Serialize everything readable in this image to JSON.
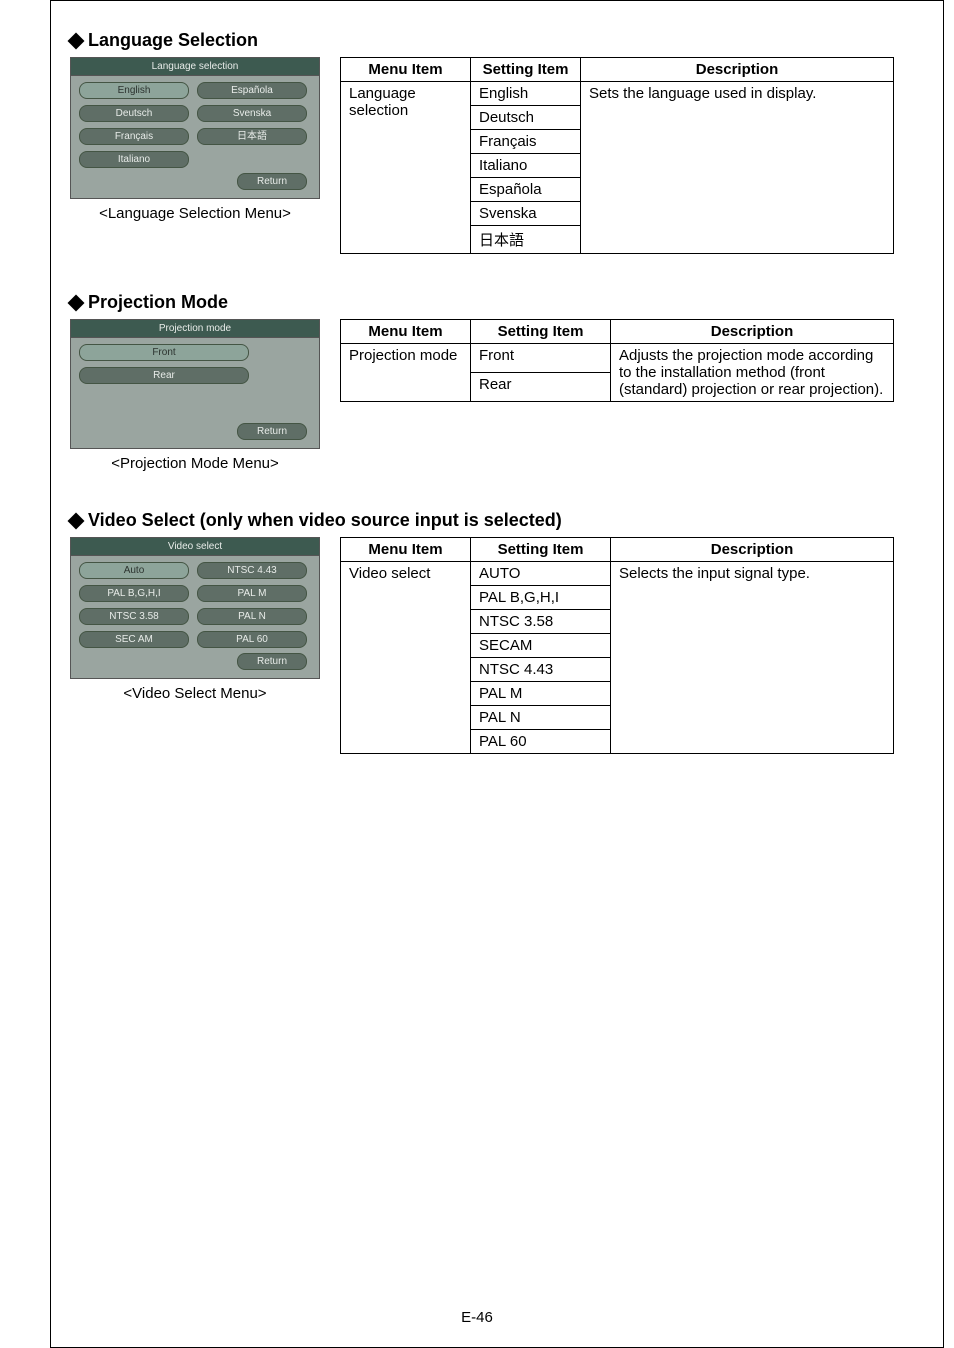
{
  "footer": "E-46",
  "sections": {
    "language": {
      "title": "Language Selection",
      "menu": {
        "header": "Language selection",
        "items_left": [
          "English",
          "Deutsch",
          "Français",
          "Italiano"
        ],
        "items_right": [
          "Española",
          "Svenska",
          "日本語"
        ],
        "return": "Return",
        "caption": "<Language Selection Menu>"
      },
      "table": {
        "headers": [
          "Menu Item",
          "Setting Item",
          "Description"
        ],
        "menu_item": "Language selection",
        "settings": [
          "English",
          "Deutsch",
          "Français",
          "Italiano",
          "Española",
          "Svenska",
          "日本語"
        ],
        "description": "Sets the language used in display."
      }
    },
    "projection": {
      "title": "Projection Mode",
      "menu": {
        "header": "Projection mode",
        "items": [
          "Front",
          "Rear"
        ],
        "return": "Return",
        "caption": "<Projection Mode Menu>"
      },
      "table": {
        "headers": [
          "Menu Item",
          "Setting Item",
          "Description"
        ],
        "menu_item": "Projection mode",
        "settings": [
          "Front",
          "Rear"
        ],
        "description": "Adjusts the projection mode according to the installation method (front (standard) projection or rear projection)."
      }
    },
    "video": {
      "title": "Video Select (only when video source input is selected)",
      "menu": {
        "header": "Video select",
        "items_left": [
          "Auto",
          "PAL B,G,H,I",
          "NTSC 3.58",
          "SEC AM"
        ],
        "items_right": [
          "NTSC 4.43",
          "PAL M",
          "PAL N",
          "PAL 60"
        ],
        "return": "Return",
        "caption": "<Video Select Menu>"
      },
      "table": {
        "headers": [
          "Menu Item",
          "Setting Item",
          "Description"
        ],
        "menu_item": "Video select",
        "settings": [
          "AUTO",
          "PAL B,G,H,I",
          "NTSC 3.58",
          "SECAM",
          "NTSC 4.43",
          "PAL M",
          "PAL N",
          "PAL 60"
        ],
        "description": "Selects the input signal type."
      }
    }
  }
}
